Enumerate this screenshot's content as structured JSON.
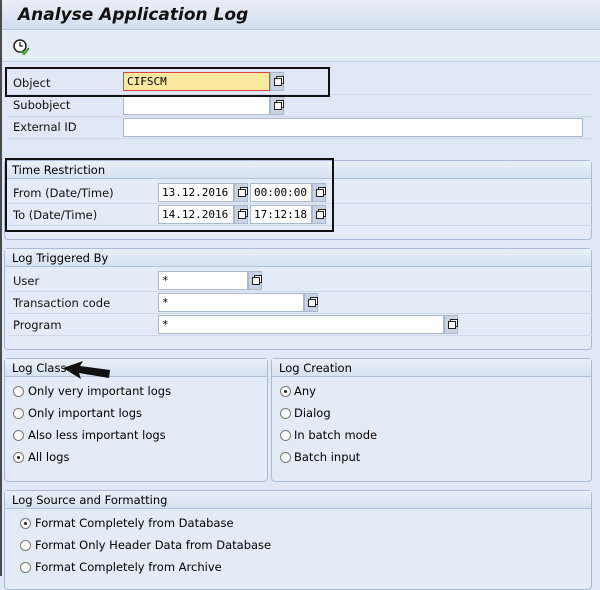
{
  "title": "Analyse Application Log",
  "toolbar": {
    "execute_icon": "clock-check-icon"
  },
  "criteria": {
    "object": {
      "label": "Object",
      "value": "CIFSCM"
    },
    "subobject": {
      "label": "Subobject",
      "value": ""
    },
    "external_id": {
      "label": "External ID",
      "value": ""
    }
  },
  "time": {
    "header": "Time Restriction",
    "from": {
      "label": "From (Date/Time)",
      "date": "13.12.2016",
      "time": "00:00:00"
    },
    "to": {
      "label": "To (Date/Time)",
      "date": "14.12.2016",
      "time": "17:12:18"
    }
  },
  "triggered": {
    "header": "Log Triggered By",
    "user": {
      "label": "User",
      "value": "*"
    },
    "tcode": {
      "label": "Transaction code",
      "value": "*"
    },
    "program": {
      "label": "Program",
      "value": "*"
    }
  },
  "log_class": {
    "header": "Log Class",
    "options": [
      "Only very important logs",
      "Only important logs",
      "Also less important logs",
      "All logs"
    ],
    "selected": 3
  },
  "log_creation": {
    "header": "Log Creation",
    "options": [
      "Any",
      "Dialog",
      "In batch mode",
      "Batch input"
    ],
    "selected": 0
  },
  "log_source": {
    "header": "Log Source and Formatting",
    "options": [
      "Format Completely from Database",
      "Format Only Header Data from Database",
      "Format Completely from Archive"
    ],
    "selected": 0
  }
}
